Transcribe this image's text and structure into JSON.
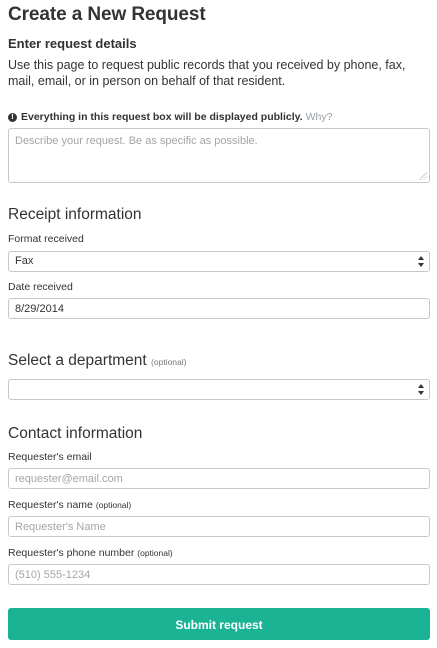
{
  "page": {
    "title": "Create a New Request",
    "subtitle": "Enter request details",
    "intro": "Use this page to request public records that you received by phone, fax, mail, email, or in person on behalf of that resident."
  },
  "notice": {
    "text": "Everything in this request box will be displayed publicly.",
    "why_link": "Why?",
    "icon": "info-icon"
  },
  "request": {
    "placeholder": "Describe your request. Be as specific as possible."
  },
  "receipt": {
    "heading": "Receipt information",
    "format_label": "Format received",
    "format_value": "Fax",
    "date_label": "Date received",
    "date_value": "8/29/2014"
  },
  "department": {
    "heading": "Select a department",
    "optional": "(optional)",
    "value": ""
  },
  "contact": {
    "heading": "Contact information",
    "email_label": "Requester's email",
    "email_placeholder": "requester@email.com",
    "name_label": "Requester's name",
    "name_optional": "(optional)",
    "name_placeholder": "Requester's Name",
    "phone_label": "Requester's phone number",
    "phone_optional": "(optional)",
    "phone_placeholder": "(510) 555-1234"
  },
  "submit": {
    "label": "Submit request"
  },
  "colors": {
    "accent": "#1ab394",
    "border": "#c8c8c8",
    "placeholder": "#a5a5a5"
  }
}
